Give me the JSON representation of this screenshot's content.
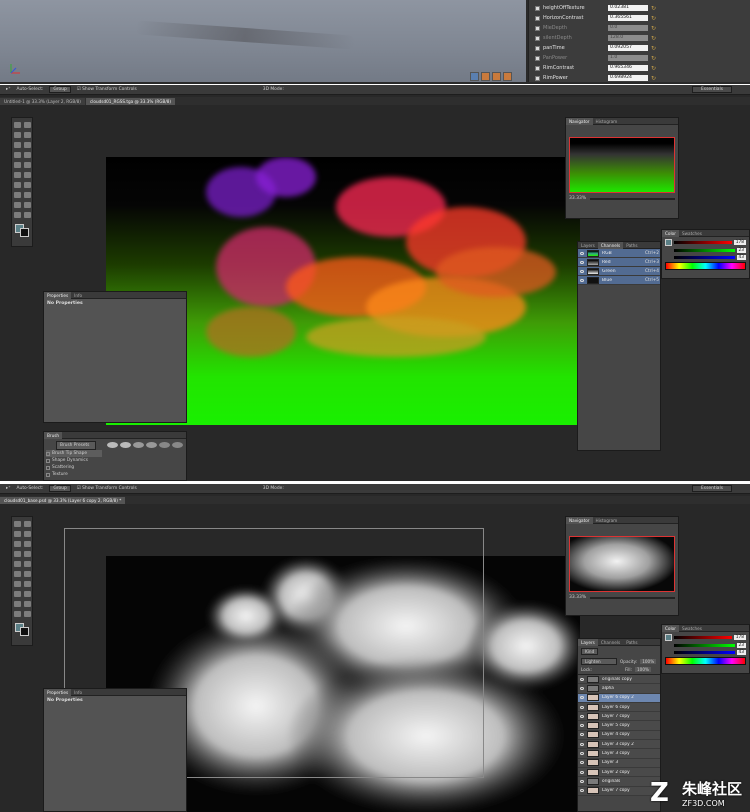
{
  "top_material": {
    "rows": [
      {
        "label": "heightOffTexture",
        "value": "0.02381",
        "enabled": true
      },
      {
        "label": "HorizonContrast",
        "value": "0.365561",
        "enabled": true
      },
      {
        "label": "MieDepth",
        "value": "0.0",
        "enabled": false
      },
      {
        "label": "silentDepth",
        "value": "128.0",
        "enabled": false
      },
      {
        "label": "panTime",
        "value": "0.092057",
        "enabled": true
      },
      {
        "label": "PanPower",
        "value": "1.0",
        "enabled": false
      },
      {
        "label": "RimContrast",
        "value": "0.965346",
        "enabled": true
      },
      {
        "label": "RimPower",
        "value": "0.698924",
        "enabled": true
      }
    ]
  },
  "window1": {
    "options": {
      "auto_select": "Auto-Select:",
      "group": "Group",
      "show_transform": "Show Transform Controls",
      "mode_3d": "3D Mode:",
      "essentials": "Essentials"
    },
    "tabs": [
      "Untitled-1 @ 33.3% (Layer 2, RGB/8)",
      "cloudsd01_RGSS.tga @ 33.3% (RGB/8)"
    ],
    "navigator": {
      "tabs": [
        "Navigator",
        "Histogram"
      ],
      "zoom": "33.33%"
    },
    "channels": {
      "tabs": [
        "Layers",
        "Channels",
        "Paths"
      ],
      "rows": [
        {
          "name": "RGB",
          "key": "Ctrl+2"
        },
        {
          "name": "Red",
          "key": "Ctrl+3"
        },
        {
          "name": "Green",
          "key": "Ctrl+4"
        },
        {
          "name": "Blue",
          "key": "Ctrl+5"
        }
      ]
    },
    "color": {
      "tabs": [
        "Color",
        "Swatches"
      ],
      "r": "178",
      "g": "23",
      "b": "43"
    },
    "properties": {
      "tabs": [
        "Properties",
        "Info"
      ],
      "title": "No Properties"
    },
    "brush": {
      "title": "Brush",
      "presets": "Brush Presets",
      "items": [
        "Brush Tip Shape",
        "Shape Dynamics",
        "Scattering",
        "Texture"
      ]
    }
  },
  "window2": {
    "options": {
      "auto_select": "Auto-Select:",
      "group": "Group",
      "show_transform": "Show Transform Controls",
      "mode_3d": "3D Mode:",
      "essentials": "Essentials"
    },
    "tabs": [
      "cloudsd01_base.psd @ 33.3% (Layer 6 copy 2, RGB/8) *"
    ],
    "navigator": {
      "tabs": [
        "Navigator",
        "Histogram"
      ],
      "zoom": "33.33%"
    },
    "layers": {
      "tabs": [
        "Layers",
        "Channels",
        "Paths"
      ],
      "kind": "Kind",
      "blend": "Lighten",
      "opacity_label": "Opacity:",
      "opacity": "100%",
      "lock_label": "Lock:",
      "fill_label": "Fill:",
      "fill": "100%",
      "rows": [
        "originals copy",
        "alpha",
        "Layer 6 copy 2",
        "Layer 6 copy",
        "Layer 7 copy",
        "Layer 5 copy",
        "Layer 4 copy",
        "Layer 3 copy 2",
        "Layer 3 copy",
        "Layer 3",
        "Layer 2 copy",
        "originals",
        "Layer 7 copy"
      ]
    },
    "color": {
      "tabs": [
        "Color",
        "Swatches"
      ],
      "r": "178",
      "g": "23",
      "b": "43"
    },
    "properties": {
      "tabs": [
        "Properties",
        "Info"
      ],
      "title": "No Properties"
    }
  },
  "watermark": {
    "title": "朱峰社区",
    "url": "ZF3D.COM",
    "logo": "Z"
  }
}
